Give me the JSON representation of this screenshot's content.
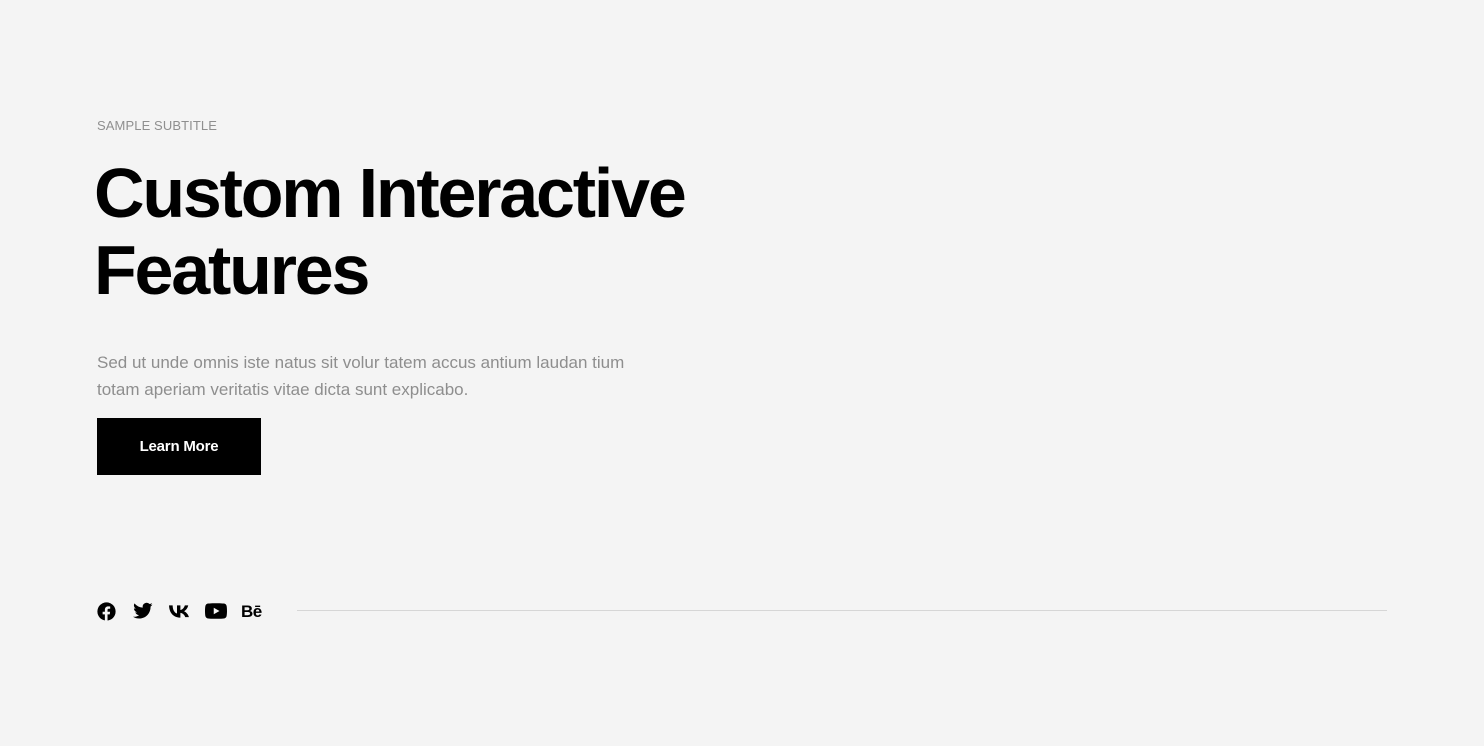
{
  "hero": {
    "subtitle": "SAMPLE SUBTITLE",
    "title_line1": "Custom Interactive",
    "title_line2": "Features",
    "description_line1": "Sed ut unde omnis iste natus sit volur tatem accus antium laudan tium",
    "description_line2": "totam aperiam veritatis vitae dicta sunt explicabo.",
    "cta_label": "Learn More"
  },
  "social": {
    "items": [
      {
        "icon": "facebook-icon"
      },
      {
        "icon": "twitter-icon"
      },
      {
        "icon": "vk-icon"
      },
      {
        "icon": "youtube-icon"
      },
      {
        "icon": "behance-icon",
        "text": "Bē"
      }
    ]
  },
  "colors": {
    "background": "#f4f4f4",
    "text": "#000000",
    "muted": "#8e8e8e",
    "button_bg": "#000000",
    "button_text": "#ffffff",
    "divider": "#d6d6d6"
  }
}
